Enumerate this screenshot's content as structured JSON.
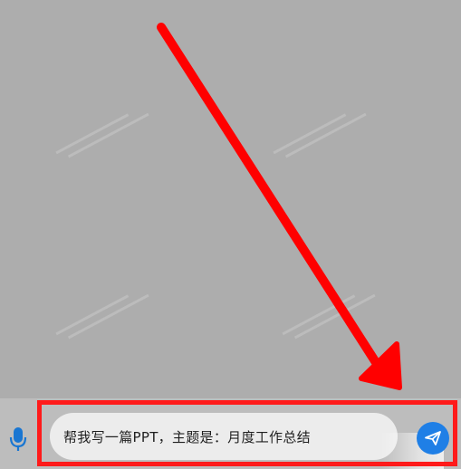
{
  "composer": {
    "input_value": "帮我写一篇PPT，主题是：月度工作总结"
  },
  "icons": {
    "voice": "microphone-icon",
    "send": "paper-plane-icon"
  },
  "colors": {
    "background": "#adadad",
    "highlight": "#ff1a1a",
    "send_button": "#1f7fe6",
    "mic": "#1976d2"
  }
}
